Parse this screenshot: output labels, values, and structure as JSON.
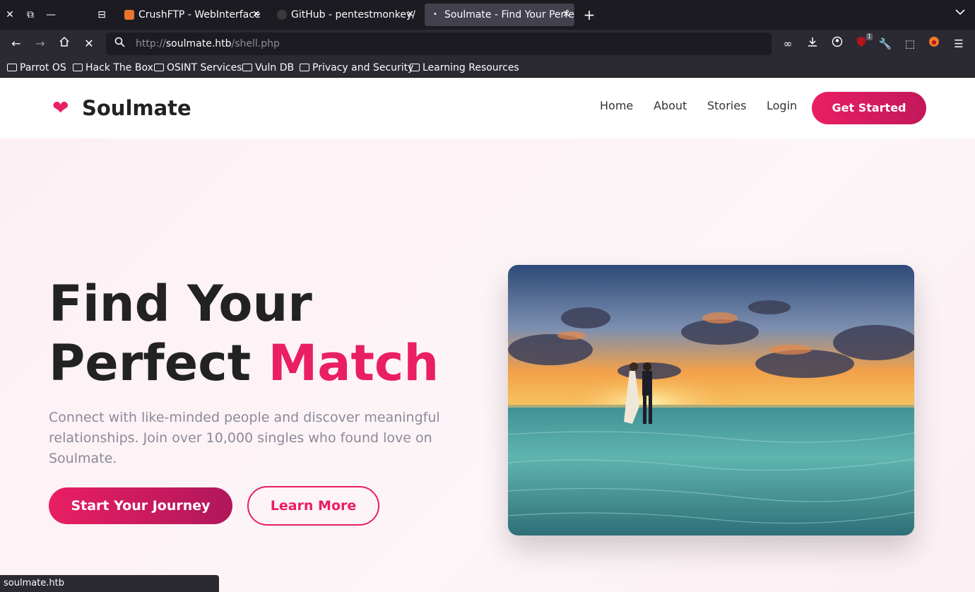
{
  "browser": {
    "tabs": [
      {
        "title": "CrushFTP - WebInterface",
        "favicon_color": "#e8752d"
      },
      {
        "title": "GitHub - pentestmonkey/",
        "favicon_color": "#3a3a3a"
      },
      {
        "title": "Soulmate - Find Your Perfe",
        "favicon_color": "#fbfbfe"
      }
    ],
    "url": {
      "scheme": "http://",
      "host": "soulmate.htb",
      "path": "/shell.php"
    },
    "bookmarks": [
      "Parrot OS",
      "Hack The Box",
      "OSINT Services",
      "Vuln DB",
      "Privacy and Security",
      "Learning Resources"
    ],
    "extension_badge": "1",
    "status_text": "soulmate.htb"
  },
  "site": {
    "brand": "Soulmate",
    "nav": [
      "Home",
      "About",
      "Stories",
      "Login"
    ],
    "cta": "Get Started",
    "hero": {
      "title_line1": "Find Your",
      "title_line2_plain": "Perfect ",
      "title_line2_accent": "Match",
      "lead": "Connect with like-minded people and discover meaningful relationships. Join over 10,000 singles who found love on Soulmate.",
      "primary_button": "Start Your Journey",
      "secondary_button": "Learn More"
    }
  },
  "colors": {
    "accent": "#e91e63",
    "chrome_dark": "#1c1b22",
    "chrome": "#2b2a33"
  }
}
